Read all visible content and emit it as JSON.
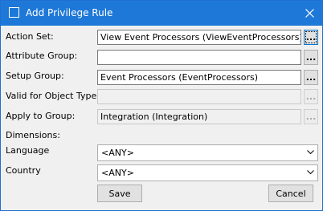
{
  "window": {
    "title": "Add Privilege Rule"
  },
  "form": {
    "action_set": {
      "label": "Action Set:",
      "value": "View Event Processors (ViewEventProcessors)",
      "browse_label": "..."
    },
    "attribute_group": {
      "label": "Attribute Group:",
      "value": "",
      "browse_label": "..."
    },
    "setup_group": {
      "label": "Setup Group:",
      "value": "Event Processors (EventProcessors)",
      "browse_label": "..."
    },
    "valid_for_object_type": {
      "label": "Valid for Object Type:",
      "value": "",
      "browse_label": "..."
    },
    "apply_to_group": {
      "label": "Apply to Group:",
      "value": "Integration (Integration)",
      "browse_label": "..."
    },
    "dimensions_label": "Dimensions:",
    "language": {
      "label": "Language",
      "value": "<ANY>"
    },
    "country": {
      "label": "Country",
      "value": "<ANY>"
    }
  },
  "buttons": {
    "save": "Save",
    "cancel": "Cancel"
  },
  "icons": {
    "title_icon": "window-icon",
    "close": "close-icon",
    "dropdown": "chevron-down-icon"
  }
}
